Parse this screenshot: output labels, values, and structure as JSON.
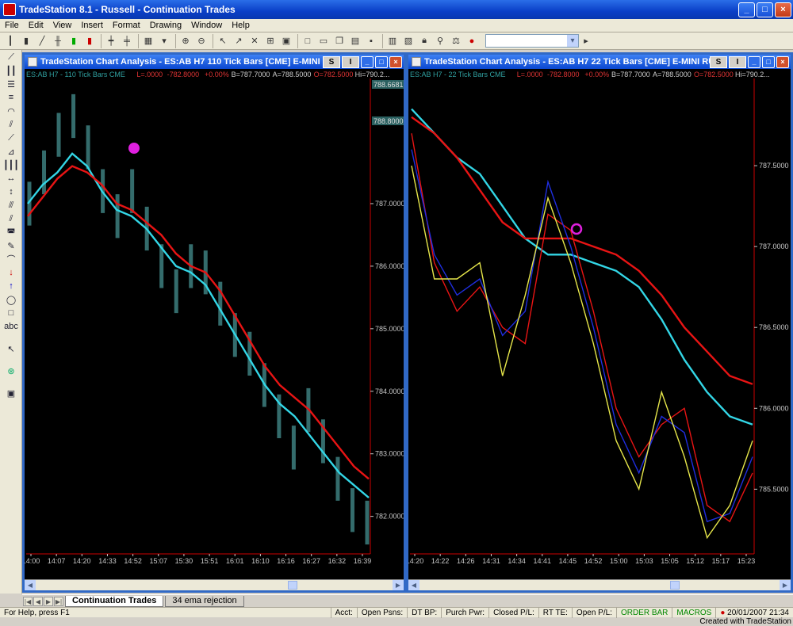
{
  "app": {
    "title": "TradeStation 8.1 - Russell - Continuation Trades",
    "controls": {
      "minimize": "_",
      "maximize": "□",
      "close": "×"
    }
  },
  "menu": [
    "File",
    "Edit",
    "View",
    "Insert",
    "Format",
    "Drawing",
    "Window",
    "Help"
  ],
  "toolbar_icons": [
    "bar-chart-icon",
    "candle-icon",
    "line-chart-icon",
    "zoom-in-icon",
    "zoom-out-icon",
    "pointer-icon",
    "tools-icon",
    "new-icon",
    "open-icon",
    "save-icon",
    "print-icon",
    "lock-icon"
  ],
  "colors": {
    "accent": "#0a3fc7",
    "chart_bg": "#000000",
    "cyan_ma": "#33d6e6",
    "red_ma": "#e81414",
    "blue_ma": "#1f2ee0",
    "yellow_line": "#e6e64a",
    "bars": "#4a9a9a",
    "axis_text": "#c8c8c8",
    "marker": "#e020e0"
  },
  "sheets": {
    "active": "Continuation Trades",
    "other": "34 ema rejection"
  },
  "status": {
    "help": "For Help, press F1",
    "acct": "Acct:",
    "open_psns": "Open Psns:",
    "dt_bp": "DT BP:",
    "purch_pwr": "Purch Pwr:",
    "closed_pl": "Closed P/L:",
    "rt_te": "RT TE:",
    "open_pl": "Open P/L:",
    "order_bar": "ORDER BAR",
    "macros": "MACROS",
    "datetime": "20/01/2007 21:34",
    "credit": "Created with TradeStation"
  },
  "charts": [
    {
      "title": "TradeStation Chart Analysis - ES:AB H7  110 Tick Bars [CME] E-MINI R...",
      "btn_s": "S",
      "btn_i": "I",
      "data_line": {
        "symbol": "ES:AB H7 - 110 Tick Bars  CME",
        "l": "L=.0000",
        "chg": "-782.8000",
        "pct": "+0.00%",
        "b": "B=787.7000",
        "a": "A=788.5000",
        "o": "O=782.5000",
        "hi": "Hi=790.2..."
      },
      "price_box_top": "788.6681",
      "price_box_2": "788.8000",
      "chart_data": {
        "type": "line",
        "title": "",
        "xlabel": "",
        "ylabel": "",
        "ylim": [
          781.4,
          788.9
        ],
        "x_ticks": [
          "14:00",
          "14:07",
          "14:20",
          "14:33",
          "14:52",
          "15:07",
          "15:30",
          "15:51",
          "16:01",
          "16:10",
          "16:16",
          "16:27",
          "16:32",
          "16:39"
        ],
        "y_ticks": [
          "787.0000",
          "786.0000",
          "785.0000",
          "784.0000",
          "783.0000",
          "782.0000"
        ],
        "series": [
          {
            "color": "#33d6e6",
            "values": [
              787.0,
              787.3,
              787.5,
              787.8,
              787.6,
              787.2,
              786.9,
              786.8,
              786.6,
              786.3,
              786.0,
              785.9,
              785.7,
              785.3,
              784.9,
              784.5,
              784.1,
              783.8,
              783.6,
              783.3,
              783.0,
              782.7,
              782.5,
              782.3
            ]
          },
          {
            "color": "#e81414",
            "values": [
              786.8,
              787.1,
              787.4,
              787.6,
              787.5,
              787.3,
              787.0,
              786.9,
              786.7,
              786.5,
              786.2,
              786.0,
              785.9,
              785.6,
              785.2,
              784.8,
              784.4,
              784.1,
              783.9,
              783.7,
              783.4,
              783.1,
              782.8,
              782.6
            ]
          }
        ],
        "bars": [
          787.0,
          787.5,
          788.1,
          788.4,
          787.9,
          787.2,
          786.8,
          787.2,
          786.6,
          786.0,
          785.6,
          786.0,
          785.9,
          785.4,
          784.9,
          784.6,
          784.1,
          783.6,
          783.1,
          783.7,
          783.2,
          782.6,
          782.1,
          781.9
        ]
      }
    },
    {
      "title": "TradeStation Chart Analysis - ES:AB H7  22 Tick Bars [CME] E-MINI RU...",
      "btn_s": "S",
      "btn_i": "I",
      "data_line": {
        "symbol": "ES:AB H7 - 22 Tick Bars  CME",
        "l": "L=.0000",
        "chg": "-782.8000",
        "pct": "+0.00%",
        "b": "B=787.7000",
        "a": "A=788.5000",
        "o": "O=782.5000",
        "hi": "Hi=790.2..."
      },
      "chart_data": {
        "type": "line",
        "title": "",
        "xlabel": "",
        "ylabel": "",
        "ylim": [
          785.1,
          788.0
        ],
        "x_ticks": [
          "14:20",
          "14:22",
          "14:26",
          "14:31",
          "14:34",
          "14:41",
          "14:45",
          "14:52",
          "15:00",
          "15:03",
          "15:05",
          "15:12",
          "15:17",
          "15:23"
        ],
        "y_ticks": [
          "787.5000",
          "787.0000",
          "786.5000",
          "786.0000",
          "785.5000"
        ],
        "series": [
          {
            "color": "#33d6e6",
            "values": [
              787.85,
              787.7,
              787.55,
              787.45,
              787.25,
              787.05,
              786.95,
              786.95,
              786.9,
              786.85,
              786.75,
              786.55,
              786.3,
              786.1,
              785.95,
              785.9
            ]
          },
          {
            "color": "#e81414",
            "values": [
              787.8,
              787.7,
              787.55,
              787.35,
              787.15,
              787.05,
              787.05,
              787.05,
              787.0,
              786.95,
              786.85,
              786.7,
              786.5,
              786.35,
              786.2,
              786.15
            ]
          },
          {
            "color": "#e81414",
            "values": [
              787.7,
              786.9,
              786.6,
              786.75,
              786.5,
              786.4,
              787.2,
              787.1,
              786.6,
              786.0,
              785.7,
              785.9,
              786.0,
              785.4,
              785.3,
              785.6
            ]
          },
          {
            "color": "#1f2ee0",
            "values": [
              787.6,
              786.95,
              786.7,
              786.8,
              786.45,
              786.6,
              787.4,
              787.0,
              786.5,
              785.9,
              785.6,
              785.95,
              785.85,
              785.3,
              785.35,
              785.7
            ]
          },
          {
            "color": "#e6e64a",
            "values": [
              787.5,
              786.8,
              786.8,
              786.9,
              786.2,
              786.7,
              787.3,
              786.9,
              786.4,
              785.8,
              785.5,
              786.1,
              785.7,
              785.2,
              785.4,
              785.8
            ]
          }
        ]
      }
    }
  ]
}
